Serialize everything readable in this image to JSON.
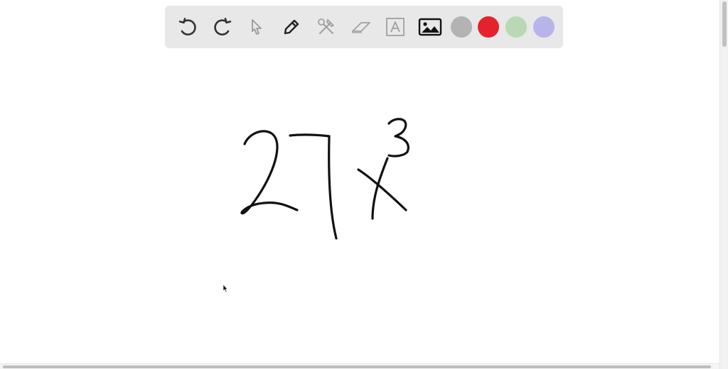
{
  "toolbar": {
    "tools": [
      {
        "icon": "undo-icon",
        "enabled": true
      },
      {
        "icon": "redo-icon",
        "enabled": true
      },
      {
        "icon": "pointer-icon",
        "enabled": false
      },
      {
        "icon": "pen-icon",
        "enabled": true
      },
      {
        "icon": "tools-icon",
        "enabled": false
      },
      {
        "icon": "eraser-icon",
        "enabled": false
      },
      {
        "icon": "text-box-icon",
        "enabled": false
      },
      {
        "icon": "image-icon",
        "enabled": true
      }
    ],
    "swatches": [
      {
        "name": "gray",
        "color": "#b3b3b3"
      },
      {
        "name": "red",
        "color": "#e3222e"
      },
      {
        "name": "green",
        "color": "#b9d8b4"
      },
      {
        "name": "lavender",
        "color": "#b6b4e9"
      }
    ]
  },
  "canvas": {
    "ink_color": "#111111",
    "handwriting_content": "27x^3"
  }
}
